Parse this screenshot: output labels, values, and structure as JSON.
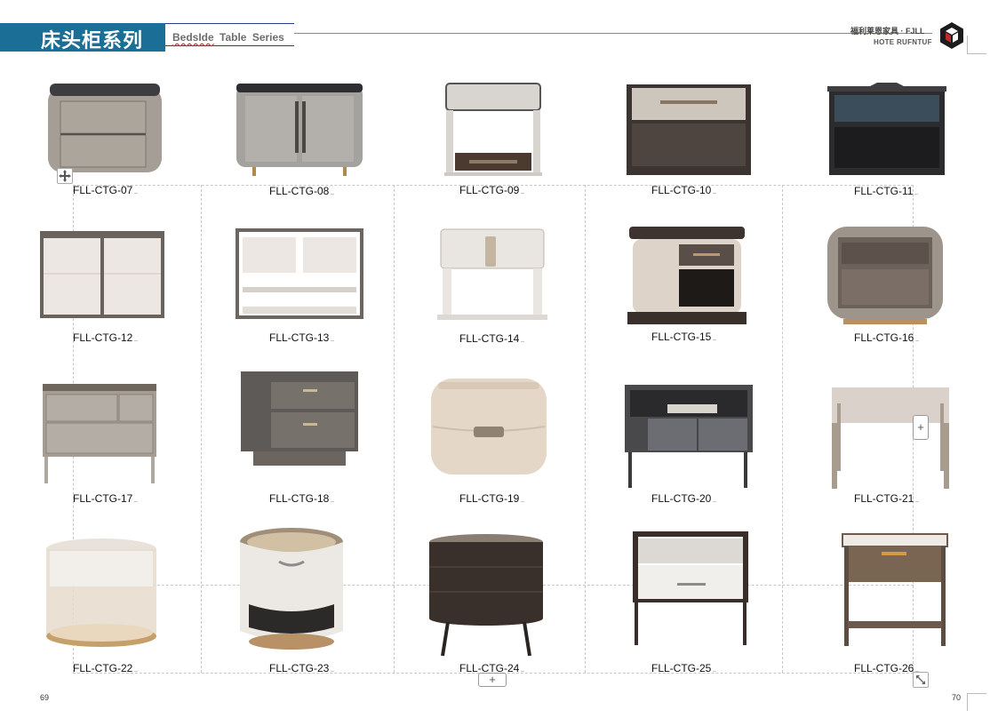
{
  "header": {
    "title_cn": "床头柜系列",
    "subtitle_word1": "BedsIde",
    "subtitle_rest": "Table  Series",
    "brand_cn": "福利莱恩家具  · FJLL",
    "brand_en": "HOTE RUFNTUF"
  },
  "colors": {
    "title_band": "#1b6e95",
    "subtitle_rule": "#2b3a8f",
    "header_rule": "#8a7fb8",
    "guide": "#c8c8c8"
  },
  "icons": {
    "move": "move-arrows-icon",
    "add": "plus-icon",
    "resize": "resize-diagonal-icon"
  },
  "products": [
    {
      "code": "FLL-CTG-07"
    },
    {
      "code": "FLL-CTG-08"
    },
    {
      "code": "FLL-CTG-09"
    },
    {
      "code": "FLL-CTG-10"
    },
    {
      "code": "FLL-CTG-11"
    },
    {
      "code": "FLL-CTG-12"
    },
    {
      "code": "FLL-CTG-13"
    },
    {
      "code": "FLL-CTG-14"
    },
    {
      "code": "FLL-CTG-15"
    },
    {
      "code": "FLL-CTG-16"
    },
    {
      "code": "FLL-CTG-17"
    },
    {
      "code": "FLL-CTG-18"
    },
    {
      "code": "FLL-CTG-19"
    },
    {
      "code": "FLL-CTG-20"
    },
    {
      "code": "FLL-CTG-21"
    },
    {
      "code": "FLL-CTG-22"
    },
    {
      "code": "FLL-CTG-23"
    },
    {
      "code": "FLL-CTG-24"
    },
    {
      "code": "FLL-CTG-25"
    },
    {
      "code": "FLL-CTG-26"
    }
  ],
  "controls": {
    "plus_label": "+"
  },
  "footer": {
    "page_left": "69",
    "page_right": "70"
  }
}
